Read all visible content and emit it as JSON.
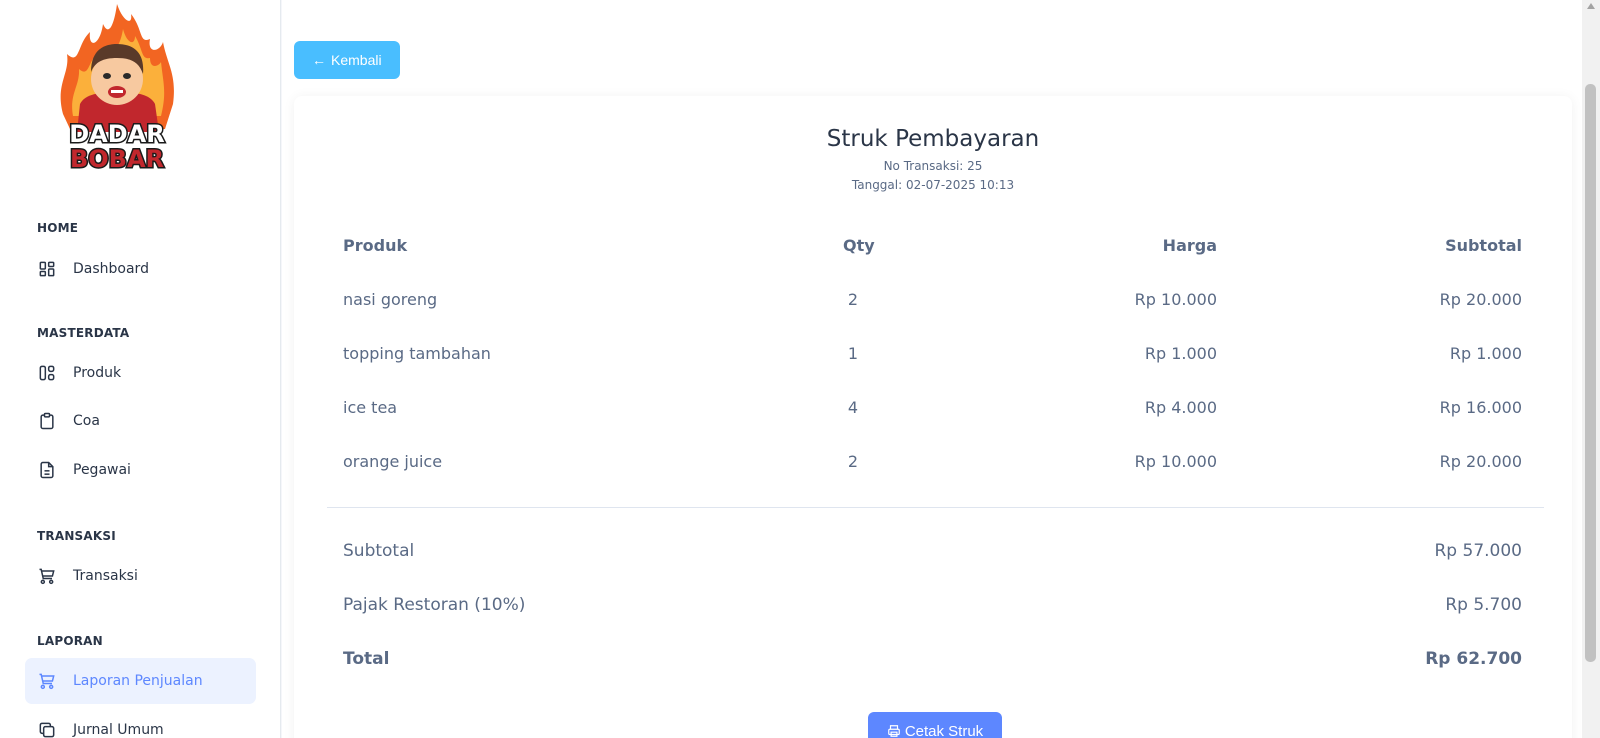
{
  "brand": {
    "logo_line1": "DADAR",
    "logo_line2": "BOBAR"
  },
  "sidebar": {
    "sections": [
      {
        "title": "HOME",
        "items": [
          {
            "label": "Dashboard",
            "icon": "dashboard-icon"
          }
        ]
      },
      {
        "title": "MASTERDATA",
        "items": [
          {
            "label": "Produk",
            "icon": "layout-icon"
          },
          {
            "label": "Coa",
            "icon": "clipboard-icon"
          },
          {
            "label": "Pegawai",
            "icon": "file-text-icon"
          }
        ]
      },
      {
        "title": "TRANSAKSI",
        "items": [
          {
            "label": "Transaksi",
            "icon": "cart-icon"
          }
        ]
      },
      {
        "title": "LAPORAN",
        "items": [
          {
            "label": "Laporan Penjualan",
            "icon": "cart-icon",
            "active": true
          },
          {
            "label": "Jurnal Umum",
            "icon": "copy-icon"
          }
        ]
      }
    ]
  },
  "back_button": {
    "label": "Kembali",
    "icon": "arrow-left-icon"
  },
  "receipt": {
    "title": "Struk Pembayaran",
    "no_transaksi": "No Transaksi: 25",
    "tanggal": "Tanggal: 02-07-2025 10:13",
    "headers": {
      "produk": "Produk",
      "qty": "Qty",
      "harga": "Harga",
      "subtotal": "Subtotal"
    },
    "items": [
      {
        "produk": "nasi goreng",
        "qty": "2",
        "harga": "Rp 10.000",
        "subtotal": "Rp 20.000"
      },
      {
        "produk": "topping tambahan",
        "qty": "1",
        "harga": "Rp 1.000",
        "subtotal": "Rp 1.000"
      },
      {
        "produk": "ice tea",
        "qty": "4",
        "harga": "Rp 4.000",
        "subtotal": "Rp 16.000"
      },
      {
        "produk": "orange juice",
        "qty": "2",
        "harga": "Rp 10.000",
        "subtotal": "Rp 20.000"
      }
    ],
    "summary": {
      "subtotal_label": "Subtotal",
      "subtotal_value": "Rp 57.000",
      "tax_label": "Pajak Restoran (10%)",
      "tax_value": "Rp 5.700",
      "total_label": "Total",
      "total_value": "Rp 62.700"
    },
    "print_button": {
      "label": "Cetak Struk",
      "icon": "printer-icon"
    }
  },
  "colors": {
    "primary": "#5d87ff",
    "info": "#49beff",
    "active_bg": "#ecf2ff"
  }
}
